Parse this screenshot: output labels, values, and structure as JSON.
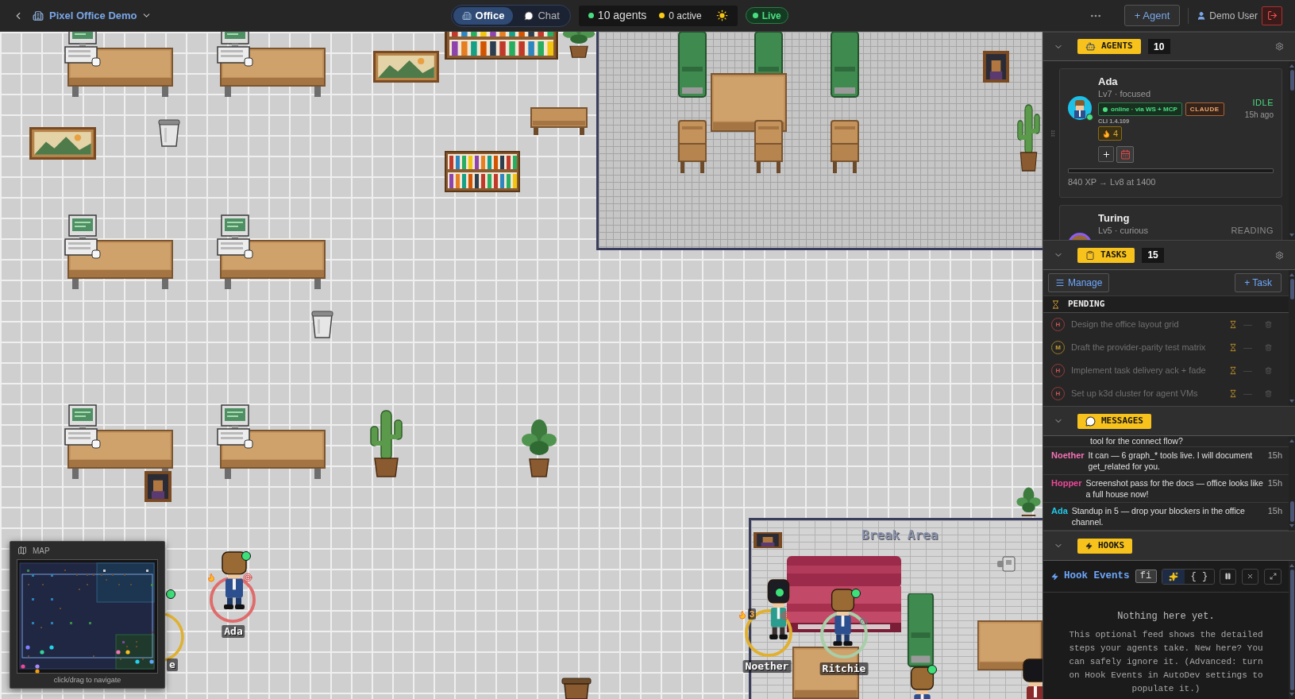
{
  "top_bar": {
    "workspace": "Pixel Office Demo",
    "views": [
      {
        "label": "Office",
        "selected": true
      },
      {
        "label": "Chat",
        "selected": false
      }
    ],
    "stats": [
      {
        "text": "10 agents",
        "color": "#4ade80"
      },
      {
        "text": "0 active",
        "color": "#facc15"
      }
    ],
    "live": {
      "label": "Live",
      "on": true
    },
    "add_agent": "+ Agent",
    "user": "Demo User"
  },
  "office": {
    "break_area": {
      "label": "Break Area"
    },
    "characters": [
      {
        "name": "Ada",
        "color": "#e06b6b"
      },
      {
        "name": "e",
        "color": "#e0b030"
      },
      {
        "name": "Noether",
        "color": "#e0b030",
        "streak": "3"
      },
      {
        "name": "Ritchie",
        "color": "#a8cfa8"
      }
    ],
    "minimap": {
      "title": "MAP",
      "hint": "click/drag to navigate"
    }
  },
  "sidebar": {
    "agents": {
      "title": "AGENTS",
      "count": "10",
      "expanded": true,
      "items": [
        {
          "name": "Ada",
          "subtitle": "Lv7 · focused",
          "connection": "online · via WS + MCP",
          "provider": "CLAUDE",
          "cli": "CLI 1.4.109",
          "streak": "4",
          "status": {
            "text": "IDLE",
            "kind": "idle"
          },
          "last_seen": "15h ago",
          "xp": {
            "text": "840 XP → Lv8 at 1400"
          }
        },
        {
          "name": "Turing",
          "subtitle": "Lv5 · curious",
          "status": {
            "text": "READING",
            "kind": "reading"
          }
        }
      ]
    },
    "tasks": {
      "title": "TASKS",
      "count": "15",
      "expanded": true,
      "manage": "Manage",
      "add": "+ Task",
      "group": "PENDING",
      "items": [
        {
          "priority": "H",
          "kind": "high",
          "title": "Design the office layout grid",
          "assignee": "—"
        },
        {
          "priority": "M",
          "kind": "medium",
          "title": "Draft the provider-parity test matrix",
          "assignee": "—"
        },
        {
          "priority": "H",
          "kind": "high",
          "title": "Implement task delivery ack + fade",
          "assignee": "—"
        },
        {
          "priority": "H",
          "kind": "high",
          "title": "Set up k3d cluster for agent VMs",
          "assignee": "—"
        }
      ]
    },
    "messages": {
      "title": "MESSAGES",
      "expanded": true,
      "items": [
        {
          "text": "tool for the connect flow?"
        },
        {
          "author": "Noether",
          "color": "#f472b6",
          "text": "It can — 6 graph_* tools live. I will document get_related for you.",
          "time": "15h"
        },
        {
          "author": "Hopper",
          "color": "#ec4899",
          "text": "Screenshot pass for the docs — office looks like a full house now!",
          "time": "15h"
        },
        {
          "author": "Ada",
          "color": "#22c7e8",
          "text": "Standup in 5 — drop your blockers in the office channel.",
          "time": "15h"
        }
      ]
    },
    "hooks": {
      "title": "HOOKS",
      "expanded": true,
      "feed_title": "Hook Events",
      "filter": "fi",
      "modes": [
        {
          "kind": "pretty",
          "selected": true
        },
        {
          "kind": "raw",
          "label": "{ }",
          "selected": false
        }
      ],
      "empty_title": "Nothing here yet.",
      "empty_text": "This optional feed shows the detailed steps your agents take. New here? You can safely ignore it. (Advanced: turn on Hook Events in AutoDev settings to populate it.)"
    }
  }
}
